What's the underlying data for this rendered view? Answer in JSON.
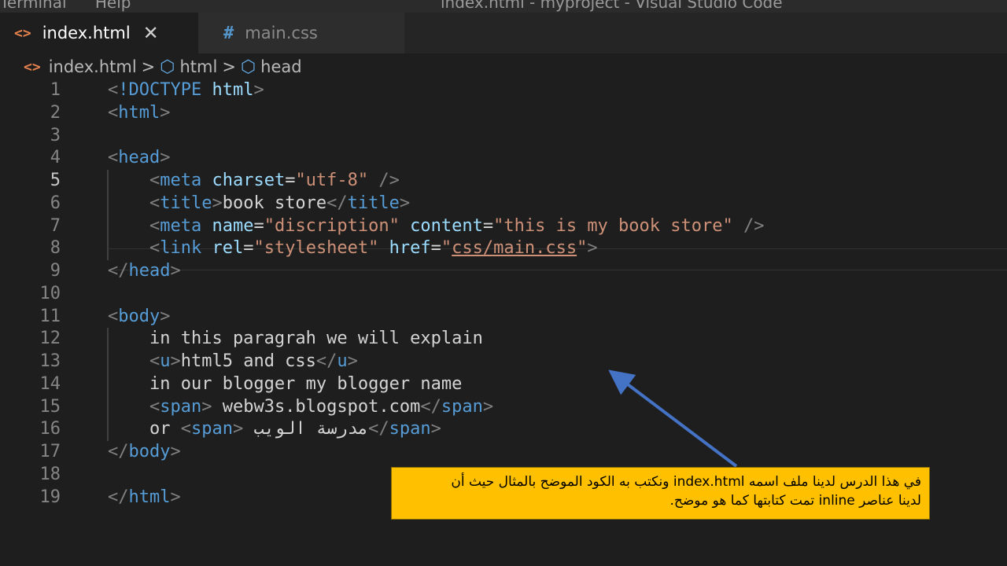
{
  "titlebar": {
    "menu": [
      "Terminal",
      "Help"
    ],
    "window_title": "index.html - myproject - Visual Studio Code"
  },
  "tabs": [
    {
      "label": "index.html",
      "icon": "html-icon",
      "active": true,
      "icon_glyph": "<>",
      "close_glyph": "✕"
    },
    {
      "label": "main.css",
      "icon": "css-hash-icon",
      "active": false,
      "icon_glyph": "#"
    }
  ],
  "breadcrumb": {
    "items": [
      "index.html",
      "html",
      "head"
    ],
    "separator": ">",
    "file_icon_glyph": "<>",
    "element_icon_glyph": "⬡"
  },
  "editor": {
    "current_line": 5,
    "lines": [
      {
        "num": "1",
        "tokens": [
          {
            "t": "tg",
            "v": "<"
          },
          {
            "t": "tn",
            "v": "!DOCTYPE"
          },
          {
            "t": "tx",
            "v": " "
          },
          {
            "t": "at",
            "v": "html"
          },
          {
            "t": "tg",
            "v": ">"
          }
        ]
      },
      {
        "num": "2",
        "tokens": [
          {
            "t": "tg",
            "v": "<"
          },
          {
            "t": "tn",
            "v": "html"
          },
          {
            "t": "tg",
            "v": ">"
          }
        ]
      },
      {
        "num": "3",
        "tokens": []
      },
      {
        "num": "4",
        "tokens": [
          {
            "t": "tg",
            "v": "<"
          },
          {
            "t": "tn",
            "v": "head"
          },
          {
            "t": "tg",
            "v": ">"
          }
        ]
      },
      {
        "num": "5",
        "tokens": [
          {
            "t": "tx",
            "v": "    "
          },
          {
            "t": "tg",
            "v": "<"
          },
          {
            "t": "tn",
            "v": "meta"
          },
          {
            "t": "tx",
            "v": " "
          },
          {
            "t": "at",
            "v": "charset"
          },
          {
            "t": "tx",
            "v": "="
          },
          {
            "t": "st",
            "v": "\"utf-8\""
          },
          {
            "t": "tx",
            "v": " "
          },
          {
            "t": "tg",
            "v": "/>"
          }
        ]
      },
      {
        "num": "6",
        "tokens": [
          {
            "t": "tx",
            "v": "    "
          },
          {
            "t": "tg",
            "v": "<"
          },
          {
            "t": "tn",
            "v": "title"
          },
          {
            "t": "tg",
            "v": ">"
          },
          {
            "t": "tx",
            "v": "book store"
          },
          {
            "t": "tg",
            "v": "</"
          },
          {
            "t": "tn",
            "v": "title"
          },
          {
            "t": "tg",
            "v": ">"
          }
        ]
      },
      {
        "num": "7",
        "tokens": [
          {
            "t": "tx",
            "v": "    "
          },
          {
            "t": "tg",
            "v": "<"
          },
          {
            "t": "tn",
            "v": "meta"
          },
          {
            "t": "tx",
            "v": " "
          },
          {
            "t": "at",
            "v": "name"
          },
          {
            "t": "tx",
            "v": "="
          },
          {
            "t": "st",
            "v": "\"discription\""
          },
          {
            "t": "tx",
            "v": " "
          },
          {
            "t": "at",
            "v": "content"
          },
          {
            "t": "tx",
            "v": "="
          },
          {
            "t": "st",
            "v": "\"this is my book store\""
          },
          {
            "t": "tx",
            "v": " "
          },
          {
            "t": "tg",
            "v": "/>"
          }
        ]
      },
      {
        "num": "8",
        "tokens": [
          {
            "t": "tx",
            "v": "    "
          },
          {
            "t": "tg",
            "v": "<"
          },
          {
            "t": "tn",
            "v": "link"
          },
          {
            "t": "tx",
            "v": " "
          },
          {
            "t": "at",
            "v": "rel"
          },
          {
            "t": "tx",
            "v": "="
          },
          {
            "t": "st",
            "v": "\"stylesheet\""
          },
          {
            "t": "tx",
            "v": " "
          },
          {
            "t": "at",
            "v": "href"
          },
          {
            "t": "tx",
            "v": "="
          },
          {
            "t": "st",
            "v": "\""
          },
          {
            "t": "stu",
            "v": "css/main.css"
          },
          {
            "t": "st",
            "v": "\""
          },
          {
            "t": "tg",
            "v": ">"
          }
        ]
      },
      {
        "num": "9",
        "tokens": [
          {
            "t": "tg",
            "v": "</"
          },
          {
            "t": "tn",
            "v": "head"
          },
          {
            "t": "tg",
            "v": ">"
          }
        ]
      },
      {
        "num": "10",
        "tokens": []
      },
      {
        "num": "11",
        "tokens": [
          {
            "t": "tg",
            "v": "<"
          },
          {
            "t": "tn",
            "v": "body"
          },
          {
            "t": "tg",
            "v": ">"
          }
        ]
      },
      {
        "num": "12",
        "tokens": [
          {
            "t": "tx",
            "v": "    in this paragrah we will explain"
          }
        ]
      },
      {
        "num": "13",
        "tokens": [
          {
            "t": "tx",
            "v": "    "
          },
          {
            "t": "tg",
            "v": "<"
          },
          {
            "t": "tn",
            "v": "u"
          },
          {
            "t": "tg",
            "v": ">"
          },
          {
            "t": "tx",
            "v": "html5 and css"
          },
          {
            "t": "tg",
            "v": "</"
          },
          {
            "t": "tn",
            "v": "u"
          },
          {
            "t": "tg",
            "v": ">"
          }
        ]
      },
      {
        "num": "14",
        "tokens": [
          {
            "t": "tx",
            "v": "    in our blogger my blogger name"
          }
        ]
      },
      {
        "num": "15",
        "tokens": [
          {
            "t": "tx",
            "v": "    "
          },
          {
            "t": "tg",
            "v": "<"
          },
          {
            "t": "tn",
            "v": "span"
          },
          {
            "t": "tg",
            "v": ">"
          },
          {
            "t": "tx",
            "v": " webw3s.blogspot.com"
          },
          {
            "t": "tg",
            "v": "</"
          },
          {
            "t": "tn",
            "v": "span"
          },
          {
            "t": "tg",
            "v": ">"
          }
        ]
      },
      {
        "num": "16",
        "tokens": [
          {
            "t": "tx",
            "v": "    or "
          },
          {
            "t": "tg",
            "v": "<"
          },
          {
            "t": "tn",
            "v": "span"
          },
          {
            "t": "tg",
            "v": ">"
          },
          {
            "t": "tx",
            "v": " مدرسة الويب"
          },
          {
            "t": "tg",
            "v": "</"
          },
          {
            "t": "tn",
            "v": "span"
          },
          {
            "t": "tg",
            "v": ">"
          }
        ]
      },
      {
        "num": "17",
        "tokens": [
          {
            "t": "tg",
            "v": "</"
          },
          {
            "t": "tn",
            "v": "body"
          },
          {
            "t": "tg",
            "v": ">"
          }
        ]
      },
      {
        "num": "18",
        "tokens": []
      },
      {
        "num": "19",
        "tokens": [
          {
            "t": "tg",
            "v": "</"
          },
          {
            "t": "tn",
            "v": "html"
          },
          {
            "t": "tg",
            "v": ">"
          }
        ]
      }
    ]
  },
  "annotation": {
    "lines": [
      "في هذا الدرس لدينا ملف اسمه index.html ونكتب به الكود الموضح بالمثال حيث أن",
      "لدينا  عناصر inline تمت كتابتها كما هو موضح."
    ],
    "background": "#ffc000",
    "arrow_color": "#4472c4"
  }
}
